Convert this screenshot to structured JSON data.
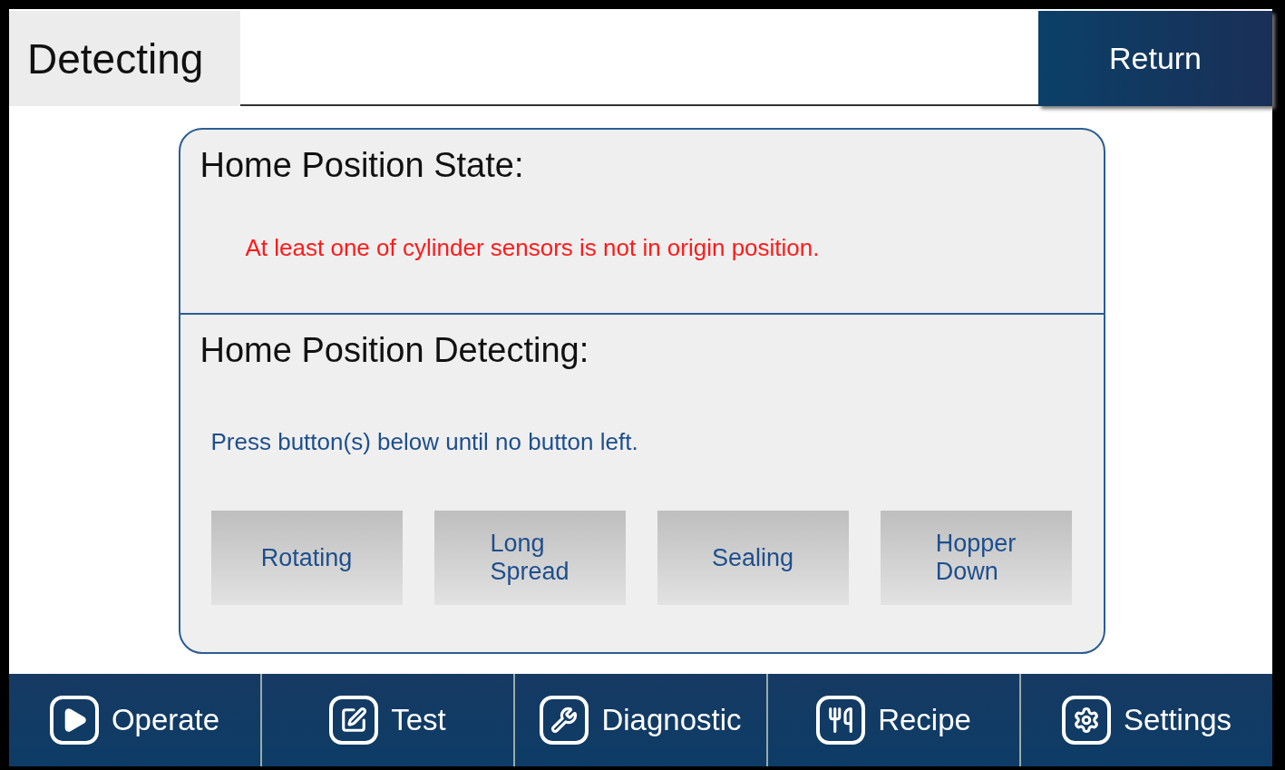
{
  "header": {
    "title": "Detecting",
    "return_button": "Return"
  },
  "state_section": {
    "heading": "Home Position State:",
    "message": "At least one of cylinder sensors is not in origin position."
  },
  "detecting_section": {
    "heading": "Home Position Detecting:",
    "instruction": "Press button(s) below until no button left.",
    "buttons": [
      {
        "label": "Rotating"
      },
      {
        "label": "Long\nSpread"
      },
      {
        "label": "Sealing"
      },
      {
        "label": "Hopper\nDown"
      }
    ]
  },
  "nav": [
    {
      "label": "Operate"
    },
    {
      "label": "Test"
    },
    {
      "label": "Diagnostic"
    },
    {
      "label": "Recipe"
    },
    {
      "label": "Settings"
    }
  ]
}
